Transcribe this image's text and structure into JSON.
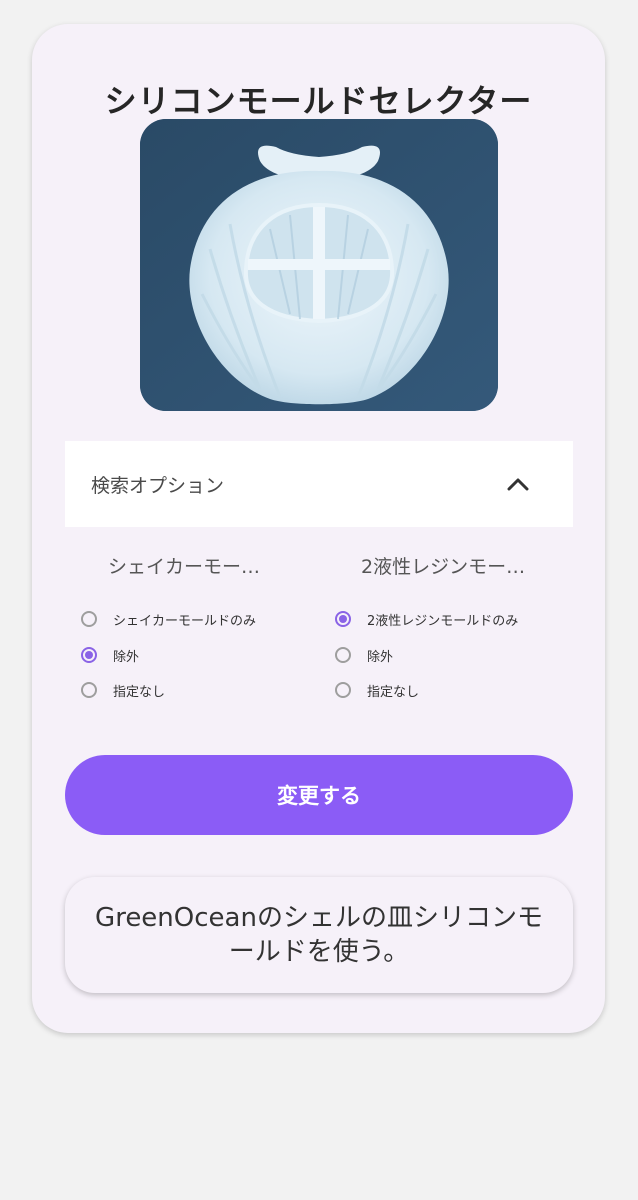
{
  "title": "シリコンモールドセレクター",
  "image": {
    "alt": "シェル型シリコンモールド",
    "background_color": "#2e5270"
  },
  "options": {
    "header_label": "検索オプション",
    "expanded": true,
    "shaker": {
      "title": "シェイカーモー…",
      "choices": [
        {
          "label": "シェイカーモールドのみ",
          "checked": false
        },
        {
          "label": "除外",
          "checked": true
        },
        {
          "label": "指定なし",
          "checked": false
        }
      ]
    },
    "resin": {
      "title": "2液性レジンモー…",
      "choices": [
        {
          "label": "2液性レジンモールドのみ",
          "checked": true
        },
        {
          "label": "除外",
          "checked": false
        },
        {
          "label": "指定なし",
          "checked": false
        }
      ]
    }
  },
  "button": {
    "label": "変更する"
  },
  "result": {
    "text": "GreenOceanのシェルの皿シリコンモールドを使う。"
  },
  "colors": {
    "accent": "#8b5cf6",
    "card_bg": "#f6f1f9",
    "page_bg": "#f2f2f2"
  }
}
